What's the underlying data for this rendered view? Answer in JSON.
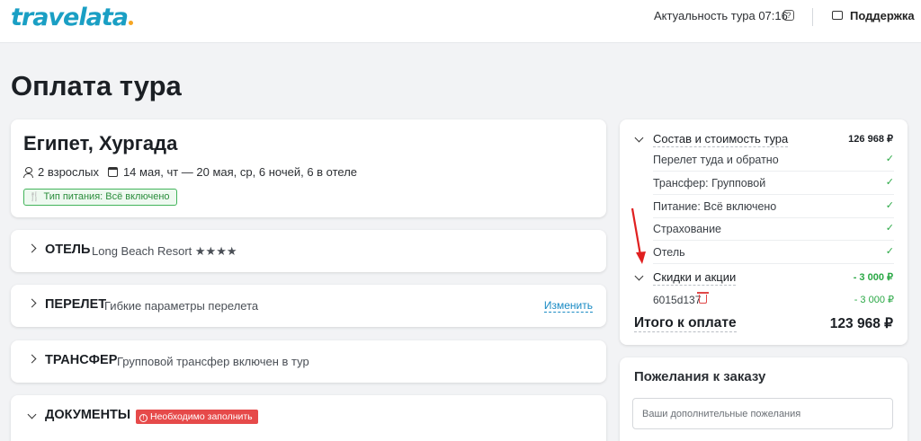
{
  "header": {
    "logo": "travelata",
    "freshness_label": "Актуальность тура 07:16",
    "help_icon": "question-icon",
    "support_label": "Поддержка",
    "support_icon": "chat-icon"
  },
  "page": {
    "title": "Оплата тура"
  },
  "destination": {
    "title": "Египет, Хургада",
    "guests": "2 взрослых",
    "dates": "14 мая, чт — 20 мая, ср, 6 ночей, 6 в отеле",
    "meal_badge": "Тип питания: Всё включено"
  },
  "sections": {
    "hotel": {
      "title": "ОТЕЛЬ",
      "subtitle": "Long Beach Resort ★★★★"
    },
    "flight": {
      "title": "ПЕРЕЛЕТ",
      "subtitle": "Гибкие параметры перелета",
      "action": "Изменить"
    },
    "transfer": {
      "title": "ТРАНСФЕР",
      "subtitle": "Групповой трансфер включен в тур"
    },
    "documents": {
      "title": "ДОКУМЕНТЫ",
      "badge": "Необходимо заполнить"
    }
  },
  "summary": {
    "composition_label": "Состав и стоимость тура",
    "composition_amount": "126 968 ₽",
    "items": [
      {
        "label": "Перелет туда и обратно"
      },
      {
        "label": "Трансфер: Групповой"
      },
      {
        "label": "Питание: Всё включено"
      },
      {
        "label": "Страхование"
      },
      {
        "label": "Отель"
      }
    ],
    "discounts_label": "Скидки и акции",
    "discounts_amount": "- 3 000 ₽",
    "promo_code": "6015d137",
    "promo_amount": "- 3 000 ₽",
    "total_label": "Итого к оплате",
    "total_amount": "123 968 ₽"
  },
  "wishes": {
    "title": "Пожелания к заказу",
    "placeholder": "Ваши дополнительные пожелания"
  },
  "colors": {
    "brand": "#1a9fc4",
    "accent_green": "#2aa845",
    "warning_red": "#e64a4a",
    "annotation_arrow": "#e02020"
  }
}
